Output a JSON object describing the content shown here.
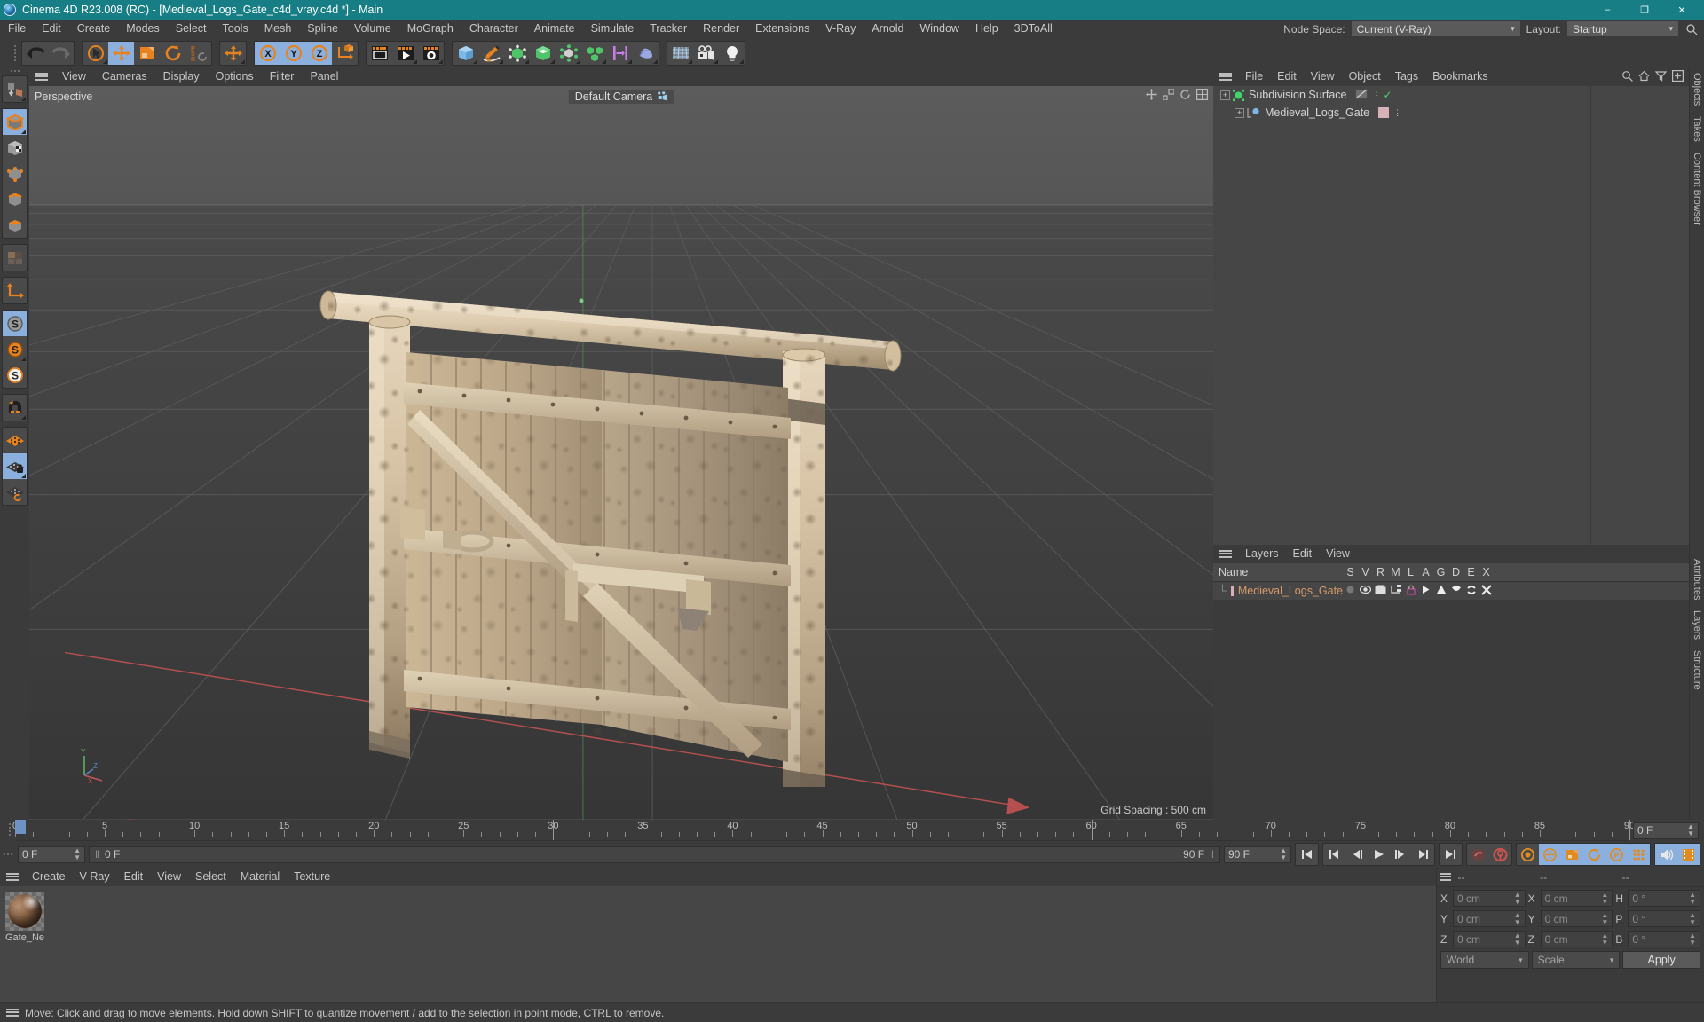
{
  "window": {
    "title": "Cinema 4D R23.008 (RC) - [Medieval_Logs_Gate_c4d_vray.c4d *] - Main",
    "minimize": "–",
    "maximize": "❐",
    "close": "✕"
  },
  "menubar": {
    "items": [
      "File",
      "Edit",
      "Create",
      "Modes",
      "Select",
      "Tools",
      "Mesh",
      "Spline",
      "Volume",
      "MoGraph",
      "Character",
      "Animate",
      "Simulate",
      "Tracker",
      "Render",
      "Extensions",
      "V-Ray",
      "Arnold",
      "Window",
      "Help",
      "3DToAll"
    ],
    "node_space_label": "Node Space:",
    "node_space_value": "Current (V-Ray)",
    "layout_label": "Layout:",
    "layout_value": "Startup"
  },
  "toolbar": {
    "groups": [
      {
        "name": "undo-redo",
        "buttons": [
          {
            "name": "undo-button",
            "icon": "undo-icon",
            "selected": false,
            "corner": false
          },
          {
            "name": "redo-button",
            "icon": "redo-icon",
            "selected": false,
            "corner": false
          }
        ]
      },
      {
        "name": "transform-tools",
        "buttons": [
          {
            "name": "live-selection-button",
            "icon": "live-selection-icon",
            "selected": false,
            "corner": true
          },
          {
            "name": "move-button",
            "icon": "move-icon",
            "selected": true,
            "corner": false
          },
          {
            "name": "scale-button",
            "icon": "scale-icon",
            "selected": false,
            "corner": false
          },
          {
            "name": "rotate-button",
            "icon": "rotate-icon",
            "selected": false,
            "corner": false
          },
          {
            "name": "psr-reset-button",
            "icon": "psr-icon",
            "selected": false,
            "corner": false
          }
        ]
      },
      {
        "name": "axis-move",
        "buttons": [
          {
            "name": "move-axis-button",
            "icon": "move-icon",
            "selected": false,
            "corner": true
          }
        ]
      },
      {
        "name": "axis-locks",
        "buttons": [
          {
            "name": "x-axis-lock-button",
            "icon": "x-axis-icon",
            "selected": true,
            "corner": false
          },
          {
            "name": "y-axis-lock-button",
            "icon": "y-axis-icon",
            "selected": true,
            "corner": false
          },
          {
            "name": "z-axis-lock-button",
            "icon": "z-axis-icon",
            "selected": true,
            "corner": false
          },
          {
            "name": "world-object-coordinates-button",
            "icon": "world-coord-icon",
            "selected": false,
            "corner": false
          }
        ]
      },
      {
        "name": "render-tools",
        "buttons": [
          {
            "name": "render-view-button",
            "icon": "render-view-icon",
            "selected": false,
            "corner": false
          },
          {
            "name": "render-to-picture-viewer-button",
            "icon": "render-picture-icon",
            "selected": false,
            "corner": true
          },
          {
            "name": "render-settings-button",
            "icon": "render-settings-icon",
            "selected": false,
            "corner": true
          }
        ]
      },
      {
        "name": "create-objects",
        "buttons": [
          {
            "name": "cube-primitive-button",
            "icon": "cube-icon",
            "selected": false,
            "corner": true
          },
          {
            "name": "spline-pen-button",
            "icon": "pen-icon",
            "selected": false,
            "corner": true
          },
          {
            "name": "nurbs-generator-button",
            "icon": "nurbs-icon",
            "selected": false,
            "corner": true
          },
          {
            "name": "scene-object-button",
            "icon": "scene-object-icon",
            "selected": false,
            "corner": true
          },
          {
            "name": "deformer-button",
            "icon": "deformer-icon",
            "selected": false,
            "corner": true
          },
          {
            "name": "mograph-button",
            "icon": "mograph-icon",
            "selected": false,
            "corner": true
          },
          {
            "name": "effector-button",
            "icon": "effector-icon",
            "selected": false,
            "corner": true
          },
          {
            "name": "field-button",
            "icon": "field-icon",
            "selected": false,
            "corner": true
          }
        ]
      },
      {
        "name": "scene-elements",
        "buttons": [
          {
            "name": "floor-button",
            "icon": "floor-icon",
            "selected": false,
            "corner": true
          },
          {
            "name": "camera-button",
            "icon": "camera-icon",
            "selected": false,
            "corner": true
          },
          {
            "name": "light-button",
            "icon": "light-icon",
            "selected": false,
            "corner": true
          }
        ]
      }
    ]
  },
  "leftbar": {
    "groups": [
      {
        "buttons": [
          {
            "name": "make-editable-button",
            "icon": "make-editable-icon",
            "selected": false,
            "corner": true
          }
        ]
      },
      {
        "buttons": [
          {
            "name": "model-mode-button",
            "icon": "model-mode-icon",
            "selected": true,
            "corner": true
          },
          {
            "name": "texture-mode-button",
            "icon": "texture-mode-icon",
            "selected": false,
            "corner": false
          },
          {
            "name": "points-mode-button",
            "icon": "points-mode-icon",
            "selected": false,
            "corner": false
          },
          {
            "name": "edges-mode-button",
            "icon": "edges-mode-icon",
            "selected": false,
            "corner": false
          },
          {
            "name": "polygons-mode-button",
            "icon": "polygons-mode-icon",
            "selected": false,
            "corner": false
          }
        ]
      },
      {
        "buttons": [
          {
            "name": "uv-mode-button",
            "icon": "uv-mode-icon",
            "selected": false,
            "corner": false
          }
        ]
      },
      {
        "buttons": [
          {
            "name": "axis-mode-button",
            "icon": "axis-mode-icon",
            "selected": false,
            "corner": false
          }
        ]
      },
      {
        "buttons": [
          {
            "name": "enable-axis-button",
            "icon": "s-gray-icon",
            "selected": true,
            "corner": false
          },
          {
            "name": "object-axis-button",
            "icon": "s-orange-icon",
            "selected": false,
            "corner": true
          },
          {
            "name": "viewport-solo-button",
            "icon": "s-white-icon",
            "selected": false,
            "corner": false
          }
        ]
      },
      {
        "buttons": [
          {
            "name": "snap-magnet-button",
            "icon": "magnet-icon",
            "selected": false,
            "corner": true
          }
        ]
      },
      {
        "buttons": [
          {
            "name": "workplane-button",
            "icon": "workplane-icon",
            "selected": false,
            "corner": false
          },
          {
            "name": "lock-workplane-button",
            "icon": "workplane-lock-icon",
            "selected": true,
            "corner": true
          },
          {
            "name": "workplane-rotate-button",
            "icon": "workplane-rotate-icon",
            "selected": false,
            "corner": false
          }
        ]
      }
    ]
  },
  "viewport": {
    "menu": [
      "View",
      "Cameras",
      "Display",
      "Options",
      "Filter",
      "Panel"
    ],
    "projection_label": "Perspective",
    "camera_label": "Default Camera",
    "grid_spacing": "Grid Spacing : 500 cm",
    "axis_labels": {
      "x": "X",
      "y": "Y",
      "z": "Z"
    }
  },
  "objects_panel": {
    "menu": [
      "File",
      "Edit",
      "View",
      "Object",
      "Tags",
      "Bookmarks"
    ],
    "icons": [
      "search-icon",
      "home-icon",
      "filter-icon",
      "add-icon"
    ],
    "rows": [
      {
        "name": "Subdivision Surface",
        "indent": 0,
        "type": "generator",
        "checked": true
      },
      {
        "name": "Medieval_Logs_Gate",
        "indent": 1,
        "type": "mesh",
        "checked": false
      }
    ]
  },
  "layers_panel": {
    "menu": [
      "Layers",
      "Edit",
      "View"
    ],
    "columns": [
      "Name",
      "S",
      "V",
      "R",
      "M",
      "L",
      "A",
      "G",
      "D",
      "E",
      "X"
    ],
    "rows": [
      {
        "name": "Medieval_Logs_Gate",
        "color": "#d8b0b8"
      }
    ]
  },
  "right_tabs": [
    "Objects",
    "Takes",
    "Content Browser",
    "Attributes",
    "Layers",
    "Structure"
  ],
  "timeline": {
    "major_ticks": [
      0,
      5,
      10,
      15,
      20,
      25,
      30,
      35,
      40,
      45,
      50,
      55,
      60,
      65,
      70,
      75,
      80,
      85,
      90
    ],
    "start_frame": "0 F",
    "end_frame": "90 F",
    "current_frame_left": "0 F",
    "current_frame_preview": "0 F",
    "preview_end": "90 F",
    "preview_end2": "90 F",
    "right_frame": "0 F",
    "playback_buttons": [
      {
        "name": "go-to-start-button",
        "icon": "skip-start-icon"
      },
      {
        "name": "previous-keyframe-button",
        "icon": "prev-key-icon"
      },
      {
        "name": "step-back-button",
        "icon": "step-back-icon"
      },
      {
        "name": "play-button",
        "icon": "play-icon"
      },
      {
        "name": "step-forward-button",
        "icon": "step-forward-icon"
      },
      {
        "name": "next-keyframe-button",
        "icon": "next-key-icon"
      },
      {
        "name": "go-to-end-button",
        "icon": "skip-end-icon"
      }
    ],
    "record_buttons": [
      {
        "name": "record-active-objects-button",
        "icon": "key-icon",
        "selected": false
      },
      {
        "name": "autokeying-button",
        "icon": "autokey-icon",
        "selected": false
      },
      {
        "name": "keyframe-selection-button",
        "icon": "keyframe-selection-icon",
        "selected": false
      },
      {
        "name": "position-key-button",
        "icon": "position-key-icon",
        "selected": true
      },
      {
        "name": "scale-key-button",
        "icon": "scale-key-icon",
        "selected": true
      },
      {
        "name": "rotation-key-button",
        "icon": "rotation-key-icon",
        "selected": true
      },
      {
        "name": "parameter-key-button",
        "icon": "param-key-icon",
        "selected": true
      },
      {
        "name": "point-level-animation-button",
        "icon": "pla-icon",
        "selected": true
      }
    ],
    "extra_buttons": [
      {
        "name": "sound-button",
        "icon": "sound-icon",
        "selected": true
      },
      {
        "name": "frame-preview-button",
        "icon": "frame-preview-icon",
        "selected": true
      }
    ]
  },
  "material_manager": {
    "menu": [
      "Create",
      "V-Ray",
      "Edit",
      "View",
      "Select",
      "Material",
      "Texture"
    ],
    "materials": [
      {
        "name": "Gate_Ne"
      }
    ]
  },
  "coordinates": {
    "headers": [
      "--",
      "--",
      "--"
    ],
    "rows": [
      {
        "label1": "X",
        "value1": "0 cm",
        "label2": "X",
        "value2": "0 cm",
        "label3": "H",
        "value3": "0 °"
      },
      {
        "label1": "Y",
        "value1": "0 cm",
        "label2": "Y",
        "value2": "0 cm",
        "label3": "P",
        "value3": "0 °"
      },
      {
        "label1": "Z",
        "value1": "0 cm",
        "label2": "Z",
        "value2": "0 cm",
        "label3": "B",
        "value3": "0 °"
      }
    ],
    "system": "World",
    "mode": "Scale",
    "apply_label": "Apply"
  },
  "statusbar": {
    "message": "Move: Click and drag to move elements. Hold down SHIFT to quantize movement / add to the selection in point mode, CTRL to remove."
  },
  "colors": {
    "title_bar": "#167e84",
    "panel_bg": "#3b3b3b",
    "list_bg": "#464646",
    "accent_selected": "#8bb0dd",
    "orange": "#e8821e",
    "layer_text": "#d79b6a",
    "layer_swatch": "#d8b0b8"
  }
}
